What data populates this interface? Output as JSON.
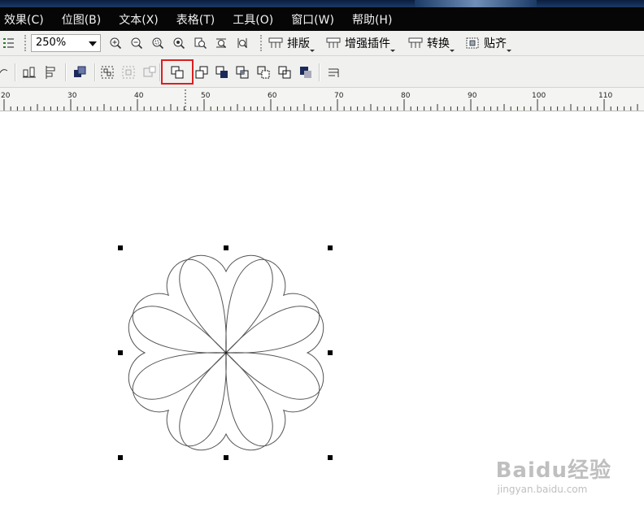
{
  "menubar": {
    "items": [
      "效果(C)",
      "位图(B)",
      "文本(X)",
      "表格(T)",
      "工具(O)",
      "窗口(W)",
      "帮助(H)"
    ]
  },
  "toolbar": {
    "zoom_value": "250%",
    "layout_label": "排版",
    "plugin_label": "增强插件",
    "convert_label": "转换",
    "snap_label": "贴齐"
  },
  "ruler": {
    "labels": [
      "20",
      "30",
      "40",
      "50",
      "60",
      "70",
      "80",
      "90",
      "100",
      "110"
    ]
  },
  "watermark": {
    "main": "Baidu经验",
    "sub": "jingyan.baidu.com"
  },
  "colors": {
    "menubar": "#060606",
    "toolbar": "#f0f0ef",
    "highlight": "#d82020",
    "outline": "#555555"
  }
}
